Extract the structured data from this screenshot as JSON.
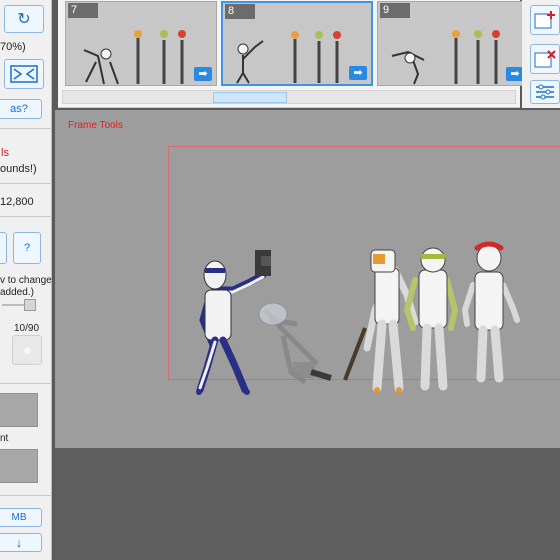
{
  "left_panel": {
    "refresh_label": "↻",
    "zoom_text": "70%)",
    "screen_label": "as?",
    "tools_text": "ls",
    "bounds_text": "ounds!)",
    "size_text": "12,800",
    "help_label": "?",
    "change_text_1": "v to change",
    "change_text_2": "added.)",
    "count_text": "10/90",
    "ent_text": "nt",
    "mb_text": "MB",
    "down_label": "↓"
  },
  "timeline": {
    "frames": [
      {
        "number": "7",
        "selected": false
      },
      {
        "number": "8",
        "selected": true
      },
      {
        "number": "9",
        "selected": false
      }
    ],
    "arrow_label": "➡"
  },
  "canvas": {
    "frame_tools_label": "Frame Tools"
  },
  "colors": {
    "accent": "#3d94e8",
    "bounds_line": "#d86b6b",
    "label_red": "#e01e1e"
  }
}
